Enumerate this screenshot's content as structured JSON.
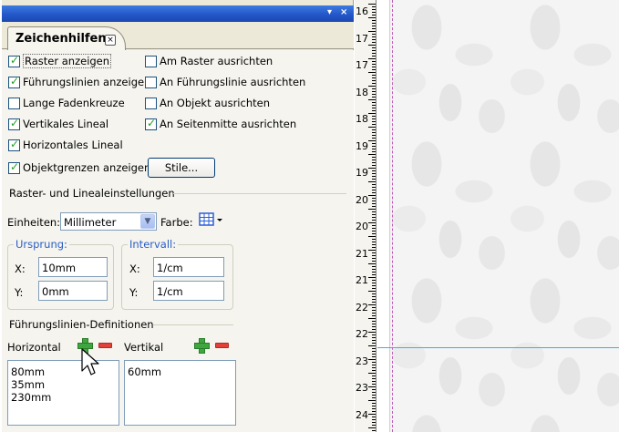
{
  "panel": {
    "title_buttons": [
      "▾",
      "×"
    ],
    "tab_label": "Zeichenhilfen",
    "tab_close": "×",
    "menu_glyph": "≡▸"
  },
  "options": {
    "raster_anzeigen": {
      "label": "Raster anzeigen",
      "checked": true
    },
    "fuehrungslinien_anzeigen": {
      "label": "Führungslinien anzeigen",
      "checked": true
    },
    "lange_fadenkreuze": {
      "label": "Lange Fadenkreuze",
      "checked": false
    },
    "vertikales_lineal": {
      "label": "Vertikales Lineal",
      "checked": true
    },
    "horizontales_lineal": {
      "label": "Horizontales Lineal",
      "checked": true
    },
    "objektgrenzen_anzeigen": {
      "label": "Objektgrenzen anzeigen",
      "checked": true
    },
    "am_raster_ausrichten": {
      "label": "Am Raster ausrichten",
      "checked": false
    },
    "an_fuehrungslinie_ausrichten": {
      "label": "An Führungslinie ausrichten",
      "checked": false
    },
    "an_objekt_ausrichten": {
      "label": "An Objekt ausrichten",
      "checked": false
    },
    "an_seitenmitte_ausrichten": {
      "label": "An Seitenmitte ausrichten",
      "checked": true
    }
  },
  "stile_button": "Stile...",
  "raster_section": {
    "title": "Raster- und Linealeinstellungen",
    "einheiten_label": "Einheiten:",
    "einheiten_value": "Millimeter",
    "farbe_label": "Farbe:",
    "ursprung": {
      "legend": "Ursprung:",
      "x_label": "X:",
      "x_value": "10mm",
      "y_label": "Y:",
      "y_value": "0mm"
    },
    "intervall": {
      "legend": "Intervall:",
      "x_label": "X:",
      "x_value": "1/cm",
      "y_label": "Y:",
      "y_value": "1/cm"
    }
  },
  "guides_section": {
    "title": "Führungslinien-Definitionen",
    "horizontal_label": "Horizontal",
    "vertikal_label": "Vertikal",
    "horizontal_items": [
      "80mm",
      "35mm",
      "230mm"
    ],
    "vertikal_items": [
      "60mm"
    ]
  },
  "ruler": {
    "labels": [
      "16",
      "17",
      "17",
      "18",
      "18",
      "19",
      "19",
      "20",
      "20",
      "21",
      "21",
      "22",
      "22",
      "23",
      "23",
      "24"
    ]
  },
  "colors": {
    "titlebar": "#2457c9",
    "legend_blue": "#2a5ec6",
    "guide_line": "#33b4e8",
    "margin_line": "#c05ab8",
    "check_green": "#21a121"
  }
}
